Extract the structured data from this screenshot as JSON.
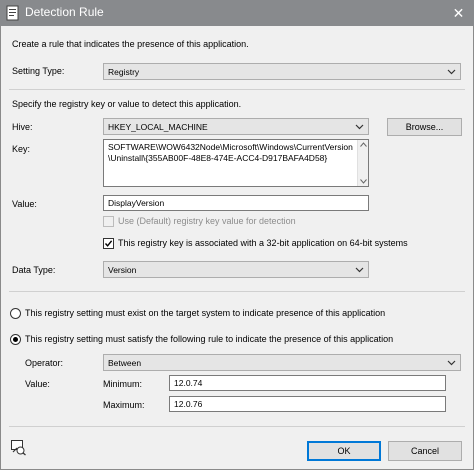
{
  "window": {
    "title": "Detection Rule",
    "close_glyph": "✕"
  },
  "intro_text": "Create a rule that indicates the presence of this application.",
  "setting_type": {
    "label": "Setting Type:",
    "value": "Registry"
  },
  "registry_intro": "Specify the registry key or value to detect this application.",
  "hive": {
    "label": "Hive:",
    "value": "HKEY_LOCAL_MACHINE",
    "browse_label": "Browse..."
  },
  "key": {
    "label": "Key:",
    "value": "SOFTWARE\\WOW6432Node\\Microsoft\\Windows\\CurrentVersion\\Uninstall\\{355AB00F-48E8-474E-ACC4-D917BAFA4D58}"
  },
  "value": {
    "label": "Value:",
    "value": "DisplayVersion"
  },
  "use_default": {
    "label": "Use (Default) registry key value for detection",
    "checked": false,
    "enabled": false
  },
  "is32bit": {
    "label": "This registry key is associated with a 32-bit application on 64-bit systems",
    "checked": true
  },
  "data_type": {
    "label": "Data Type:",
    "value": "Version"
  },
  "radio_exist": {
    "label": "This registry setting must exist on the target system to indicate presence of this application",
    "checked": false
  },
  "radio_satisfy": {
    "label": "This registry setting must satisfy the following rule to indicate the presence of this application",
    "checked": true
  },
  "operator": {
    "label": "Operator:",
    "value": "Between"
  },
  "rule_value": {
    "label": "Value:",
    "minimum_label": "Minimum:",
    "minimum": "12.0.74",
    "maximum_label": "Maximum:",
    "maximum": "12.0.76"
  },
  "footer": {
    "ok_label": "OK",
    "cancel_label": "Cancel"
  },
  "colors": {
    "titlebar": "#888a8d",
    "accent": "#0078d7",
    "dialog_bg": "#f0f0f0"
  }
}
